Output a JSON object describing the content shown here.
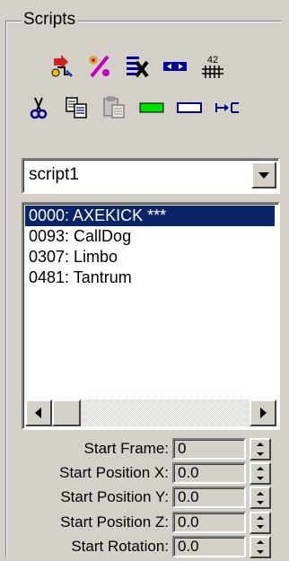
{
  "panel": {
    "title": "Scripts"
  },
  "toolbar_row1": [
    {
      "icon": "merge-scripts-icon"
    },
    {
      "icon": "percent-icon"
    },
    {
      "icon": "delete-script-icon"
    },
    {
      "icon": "fit-range-icon"
    },
    {
      "icon": "renumber-icon",
      "text": "42"
    }
  ],
  "toolbar_row2": [
    {
      "icon": "cut-icon"
    },
    {
      "icon": "copy-icon"
    },
    {
      "icon": "paste-icon"
    },
    {
      "icon": "green-bar-icon"
    },
    {
      "icon": "white-bar-icon"
    },
    {
      "icon": "insert-bar-icon"
    }
  ],
  "script_select": {
    "value": "script1"
  },
  "script_list": {
    "items": [
      {
        "label": "0000: AXEKICK  ***",
        "selected": true
      },
      {
        "label": "0093: CallDog",
        "selected": false
      },
      {
        "label": "0307: Limbo",
        "selected": false
      },
      {
        "label": "0481: Tantrum",
        "selected": false
      }
    ]
  },
  "fields": {
    "start_frame": {
      "label": "Start Frame:",
      "value": "0"
    },
    "start_pos_x": {
      "label": "Start Position X:",
      "value": "0.0"
    },
    "start_pos_y": {
      "label": "Start Position Y:",
      "value": "0.0"
    },
    "start_pos_z": {
      "label": "Start Position Z:",
      "value": "0.0"
    },
    "start_rotation": {
      "label": "Start Rotation:",
      "value": "0.0"
    }
  },
  "colors": {
    "selection": "#0a246a",
    "panel_bg": "#d4d0c8"
  }
}
